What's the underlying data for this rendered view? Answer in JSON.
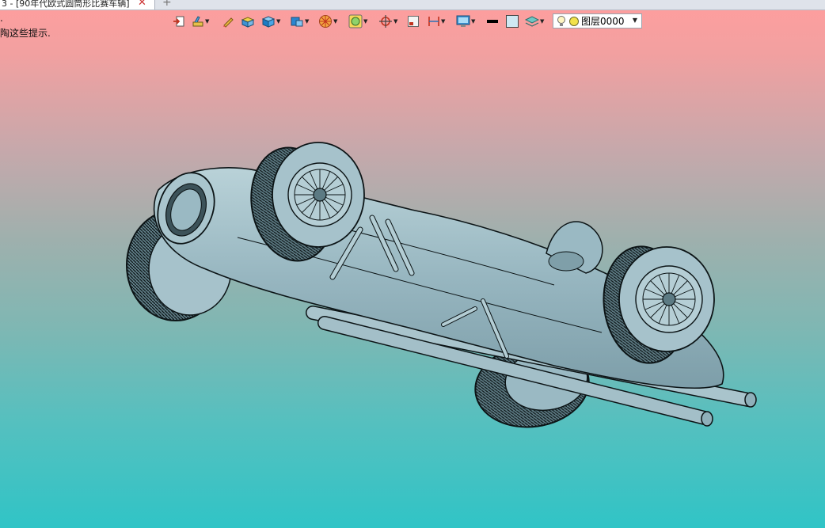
{
  "tab": {
    "title": "3 - [90年代欧式圆筒形比赛车辆]",
    "close_glyph": "✕",
    "new_glyph": "+"
  },
  "hint": {
    "line1": ".",
    "line2": "陶这些提示."
  },
  "toolbar": {
    "icons": [
      "import-icon",
      "paint-brush-icon",
      "pencil-icon",
      "box-render-icon",
      "shaded-cube-icon",
      "view-cube-icon",
      "color-wheel-icon",
      "material-icon",
      "snap-target-icon",
      "frame-icon",
      "dimension-icon",
      "monitor-icon",
      "line-color-icon",
      "fill-color-icon",
      "layer-stack-icon"
    ],
    "line_color": "#000000",
    "fill_color": "#cfe8f3",
    "layer": {
      "name": "图层0000",
      "indicator_color": "#f2e24a"
    }
  },
  "viewport": {
    "background_top": "#ff9e9e",
    "background_bottom": "#30c4c6",
    "model_color": "#9ab9c3"
  }
}
